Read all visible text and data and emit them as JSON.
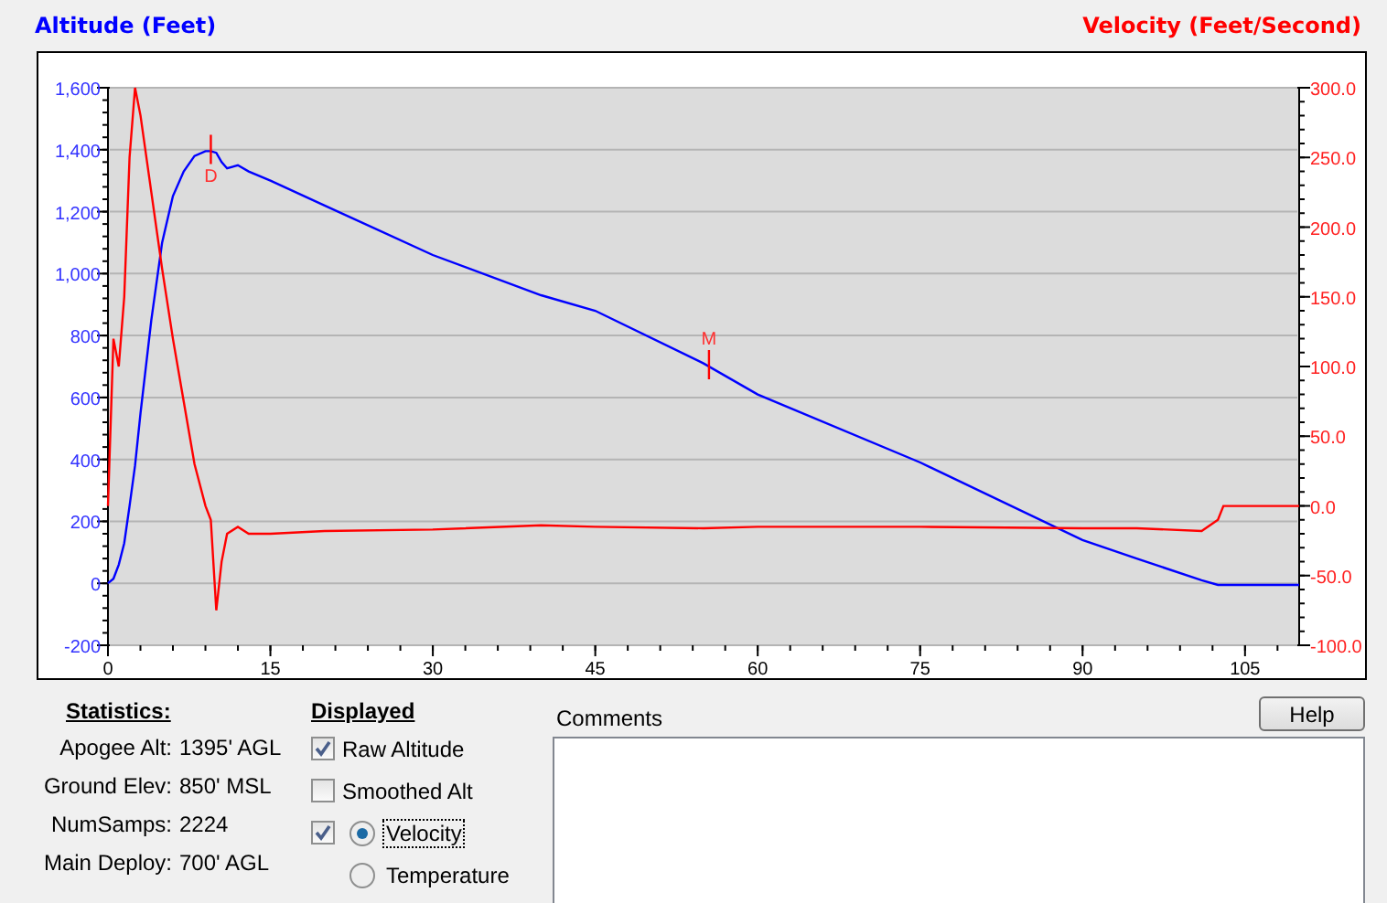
{
  "chart_data": {
    "type": "line",
    "ylabel": "Altitude (Feet)",
    "y2label": "Velocity (Feet/Second)",
    "x": [
      0,
      0.5,
      1,
      1.5,
      2,
      2.5,
      3,
      4,
      5,
      6,
      7,
      8,
      9,
      9.5,
      10,
      10.5,
      11,
      12,
      13,
      15,
      20,
      30,
      40,
      45,
      55,
      60,
      75,
      90,
      95,
      101,
      102.5,
      103,
      110
    ],
    "series": [
      {
        "color": "#0000ff",
        "values": [
          0,
          15,
          60,
          130,
          250,
          380,
          550,
          850,
          1100,
          1250,
          1330,
          1380,
          1395,
          1395,
          1390,
          1360,
          1340,
          1350,
          1330,
          1300,
          1220,
          1060,
          930,
          880,
          710,
          610,
          390,
          140,
          80,
          10,
          -5,
          -5,
          -5
        ]
      },
      {
        "axis": "y2",
        "color": "#ff0000",
        "values": [
          0,
          120,
          100,
          150,
          250,
          300,
          280,
          225,
          170,
          120,
          75,
          30,
          0,
          -10,
          -75,
          -40,
          -20,
          -15,
          -20,
          -20,
          -18,
          -17,
          -14,
          -15,
          -16,
          -15,
          -15,
          -16,
          -16,
          -18,
          -10,
          0,
          0
        ]
      }
    ],
    "grid": true,
    "xlim": [
      0,
      110
    ],
    "ylim": [
      -200,
      1600
    ],
    "y2lim": [
      -100,
      300
    ],
    "xticks": [
      0,
      15,
      30,
      45,
      60,
      75,
      90,
      105
    ],
    "yticks": [
      {
        "value": -200,
        "label": "-200"
      },
      {
        "value": 0,
        "label": "0"
      },
      {
        "value": 200,
        "label": "200"
      },
      {
        "value": 400,
        "label": "400"
      },
      {
        "value": 600,
        "label": "600"
      },
      {
        "value": 800,
        "label": "800"
      },
      {
        "value": 1000,
        "label": "1,000"
      },
      {
        "value": 1200,
        "label": "1,200"
      },
      {
        "value": 1400,
        "label": "1,400"
      },
      {
        "value": 1600,
        "label": "1,600"
      }
    ],
    "y2ticks": [
      {
        "value": -100,
        "label": "-100.0"
      },
      {
        "value": -50,
        "label": "-50.0"
      },
      {
        "value": 0,
        "label": "0.0"
      },
      {
        "value": 50,
        "label": "50.0"
      },
      {
        "value": 100,
        "label": "100.0"
      },
      {
        "value": 150,
        "label": "150.0"
      },
      {
        "value": 200,
        "label": "200.0"
      },
      {
        "value": 250,
        "label": "250.0"
      },
      {
        "value": 300,
        "label": "300.0"
      }
    ],
    "annotations": [
      {
        "x": 9.5,
        "y": 1395,
        "text": "D"
      },
      {
        "x": 55.5,
        "y": 700,
        "text": "M"
      }
    ]
  },
  "statistics": {
    "heading": "Statistics:",
    "rows": [
      {
        "label": "Apogee Alt:",
        "value": "1395' AGL"
      },
      {
        "label": "Ground Elev:",
        "value": "850' MSL"
      },
      {
        "label": "NumSamps:",
        "value": "2224"
      },
      {
        "label": "Main Deploy:",
        "value": "700' AGL"
      }
    ]
  },
  "displayed": {
    "heading": "Displayed",
    "checkboxes": [
      {
        "label": "Raw Altitude",
        "checked": true
      },
      {
        "label": "Smoothed Alt",
        "checked": false
      }
    ],
    "third_series": {
      "checked": true,
      "options": [
        {
          "label": "Velocity",
          "selected": true,
          "focused": true
        },
        {
          "label": "Temperature",
          "selected": false,
          "focused": false
        }
      ]
    }
  },
  "comments": {
    "label": "Comments"
  },
  "help_button": "Help"
}
